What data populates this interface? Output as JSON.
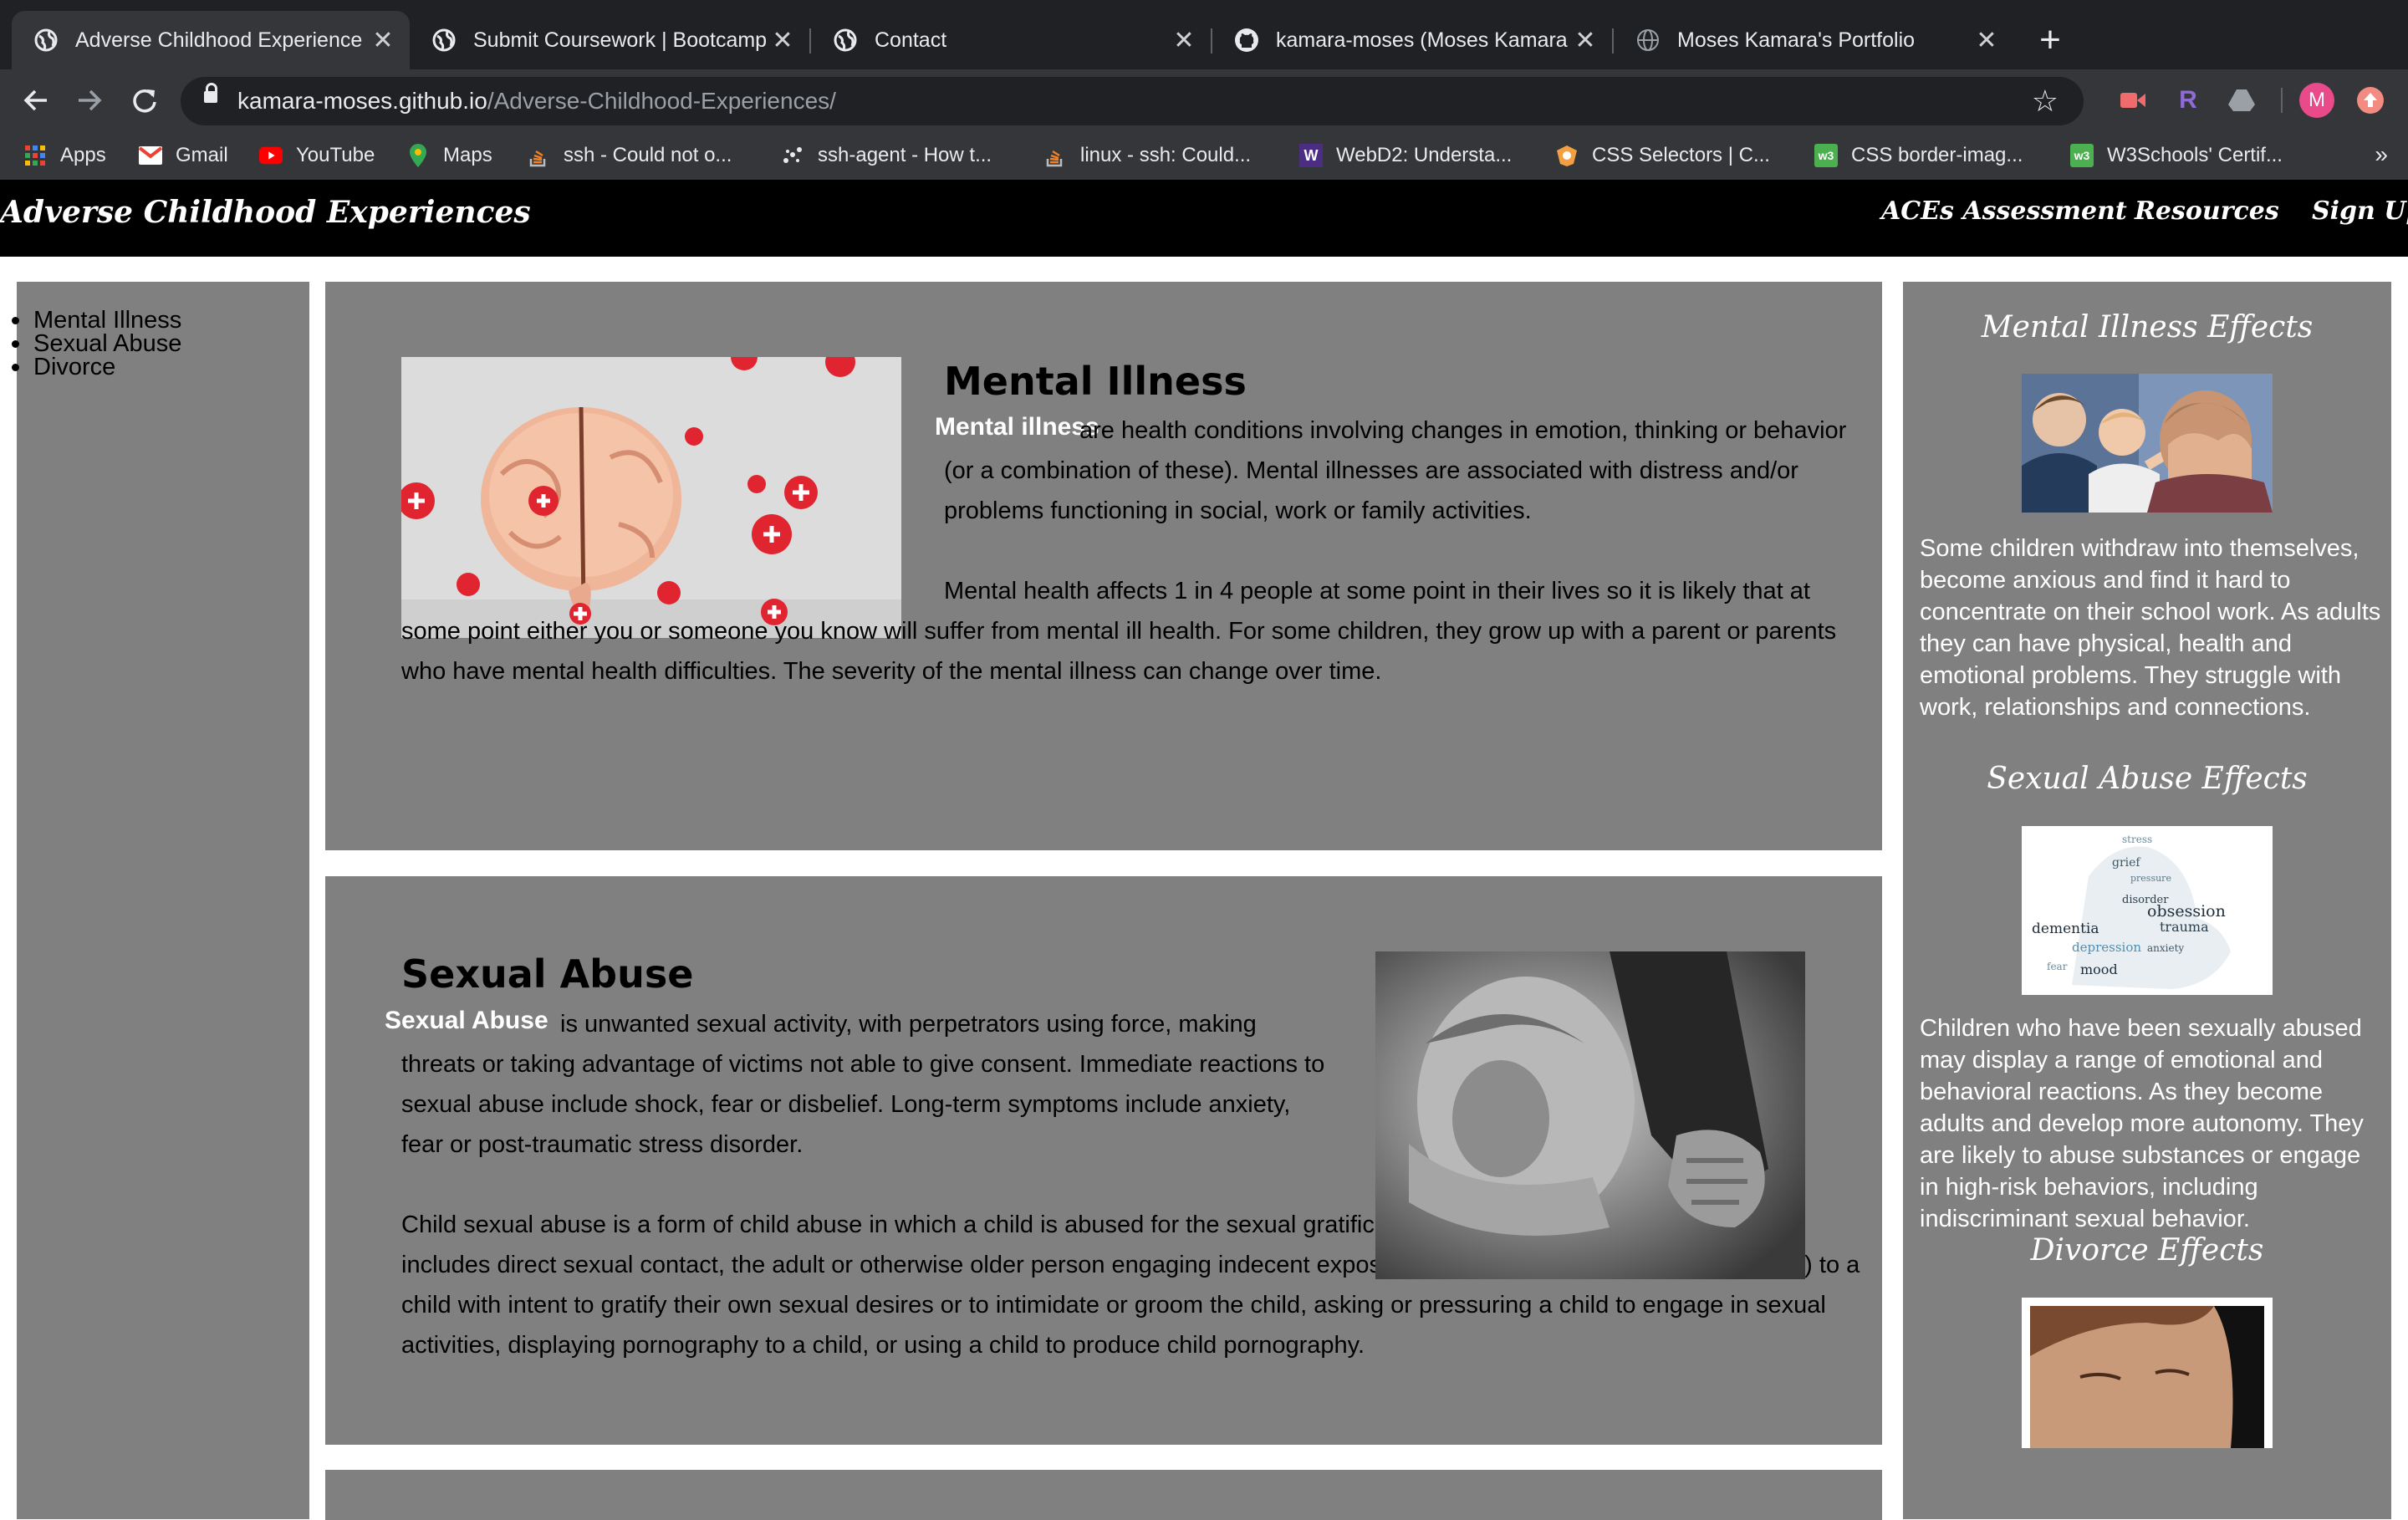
{
  "browser": {
    "tabs": [
      {
        "title": "Adverse Childhood Experience",
        "active": true,
        "icon": "globe-icon"
      },
      {
        "title": "Submit Coursework | Bootcamp",
        "active": false,
        "icon": "globe-icon"
      },
      {
        "title": "Contact",
        "active": false,
        "icon": "globe-icon"
      },
      {
        "title": "kamara-moses (Moses Kamara",
        "active": false,
        "icon": "github-icon"
      },
      {
        "title": "Moses Kamara's Portfolio",
        "active": false,
        "icon": "globe-icon"
      }
    ],
    "close_glyph": "✕",
    "new_tab_glyph": "+",
    "url_host": "kamara-moses.github.io",
    "url_path": "/Adverse-Childhood-Experiences/",
    "profile_initial": "M",
    "bookmarks": [
      {
        "label": "Apps",
        "icon": "apps-grid-icon"
      },
      {
        "label": "Gmail",
        "icon": "gmail-icon"
      },
      {
        "label": "YouTube",
        "icon": "youtube-icon"
      },
      {
        "label": "Maps",
        "icon": "maps-pin-icon"
      },
      {
        "label": "ssh - Could not o...",
        "icon": "stackoverflow-icon"
      },
      {
        "label": "ssh-agent - How t...",
        "icon": "dots-icon"
      },
      {
        "label": "linux - ssh: Could...",
        "icon": "stackoverflow-icon"
      },
      {
        "label": "WebD2: Understa...",
        "icon": "w-logo-icon"
      },
      {
        "label": "CSS Selectors | C...",
        "icon": "css-icon"
      },
      {
        "label": "CSS border-imag...",
        "icon": "w3schools-icon"
      },
      {
        "label": "W3Schools' Certif...",
        "icon": "w3schools-icon"
      }
    ],
    "bookmarks_more": "»"
  },
  "site": {
    "brand": "Adverse Childhood Experiences",
    "nav": [
      "ACEs Assessment",
      "Resources",
      "Sign Up"
    ],
    "sidebar_links": [
      "Mental Illness",
      "Sexual Abuse",
      "Divorce"
    ],
    "sections": [
      {
        "heading": "Mental Illness",
        "lead": "Mental illness",
        "para1_lead_rest": "are health conditions involving changes in emotion, thinking or behavior (or a combination of these). Mental illnesses are associated with distress and/or problems functioning in social, work or family activities.",
        "para2": "Mental health affects 1 in 4 people at some point in their lives so it is likely that at some point either you or someone you know will suffer from mental ill health. For some children, they grow up with a parent or parents who have mental health difficulties. The severity of the mental illness can change over time."
      },
      {
        "heading": "Sexual Abuse",
        "lead": "Sexual Abuse",
        "para1_lead_rest": "is unwanted sexual activity, with perpetrators using force, making threats or taking advantage of victims not able to give consent. Immediate reactions to sexual abuse include shock, fear or disbelief. Long-term symptoms include anxiety, fear or post-traumatic stress disorder.",
        "para2": "Child sexual abuse is a form of child abuse in which a child is abused for the sexual gratification of an adult or older adolescent. It includes direct sexual contact, the adult or otherwise older person engaging indecent exposure (of the genitals, female nipples, etc.) to a child with intent to gratify their own sexual desires or to intimidate or groom the child, asking or pressuring a child to engage in sexual activities, displaying pornography to a child, or using a child to produce child pornography."
      }
    ],
    "effects": [
      {
        "title": "Mental Illness Effects",
        "text": "Some children withdraw into themselves, become anxious and find it hard to concentrate on their school work. As adults they can have physical, health and emotional problems. They struggle with work, relationships and connections."
      },
      {
        "title": "Sexual Abuse Effects",
        "text": "Children who have been sexually abused may display a range of emotional and behavioral reactions. As they become adults and develop more autonomy. They are likely to abuse substances or engage in high-risk behaviors, including indiscriminant sexual behavior."
      },
      {
        "title": "Divorce Effects",
        "text": ""
      }
    ],
    "word_cloud": [
      "obsession",
      "trauma",
      "dementia",
      "depression",
      "anxiety",
      "pressure",
      "fear",
      "mood",
      "disorder",
      "grief",
      "stress"
    ]
  },
  "colors": {
    "chrome_dark": "#202124",
    "chrome_toolbar": "#35363a",
    "nav_bg": "#000000",
    "panel_gray": "#808080",
    "lead_text": "#ffffff"
  }
}
